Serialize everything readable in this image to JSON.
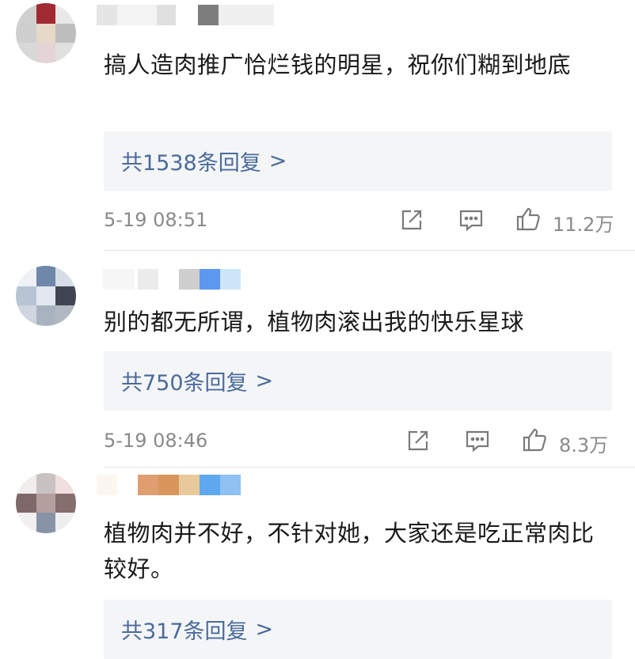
{
  "comments": [
    {
      "text": "搞人造肉推广恰烂钱的明星，祝你们糊到地底",
      "reply_label": "共1538条回复",
      "reply_arrow": ">",
      "time": "5-19 08:51",
      "likes": "11.2万",
      "icons": [
        "share-icon",
        "comment-icon",
        "like-icon"
      ]
    },
    {
      "text": "别的都无所谓，植物肉滚出我的快乐星球",
      "reply_label": "共750条回复",
      "reply_arrow": ">",
      "time": "5-19 08:46",
      "likes": "8.3万",
      "icons": [
        "share-icon",
        "comment-icon",
        "like-icon"
      ]
    },
    {
      "text": "植物肉并不好，不针对她，大家还是吃正常肉比较好。",
      "reply_label": "共317条回复",
      "reply_arrow": ">"
    }
  ],
  "colors": {
    "reply_link": "#4a6b9a",
    "reply_bg": "#f4f5f7",
    "meta_text": "#8a8a8a"
  }
}
